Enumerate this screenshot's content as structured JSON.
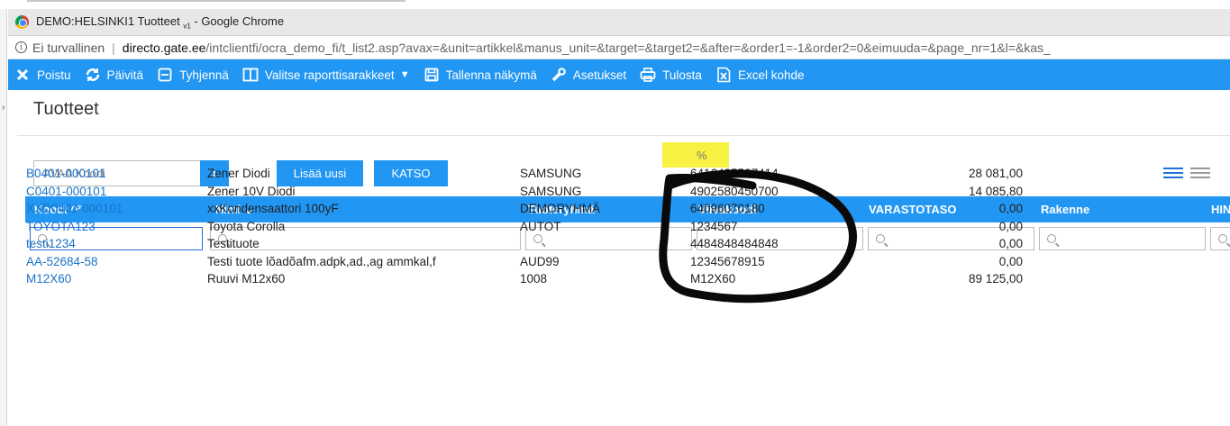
{
  "browser": {
    "window_title": "DEMO:HELSINKI1 Tuotteet",
    "window_title_sub": "v1",
    "window_title_app": " - Google Chrome",
    "insecure_label": "Ei turvallinen",
    "url_host": "directo.gate.ee",
    "url_path": "/intclientfi/ocra_demo_fi/t_list2.asp?avax=&unit=artikkel&manus_unit=&target=&target2=&after=&order1=-1&order2=0&eimuuda=&page_nr=1&l=&kas_"
  },
  "toolbar": {
    "items": [
      {
        "label": "Poistu",
        "icon": "close-icon"
      },
      {
        "label": "Päivitä",
        "icon": "refresh-icon"
      },
      {
        "label": "Tyhjennä",
        "icon": "minus-box-icon"
      },
      {
        "label": "Valitse raporttisarakkeet",
        "icon": "columns-icon"
      },
      {
        "label": "Tallenna näkymä",
        "icon": "save-icon"
      },
      {
        "label": "Asetukset",
        "icon": "wrench-icon"
      },
      {
        "label": "Tulosta",
        "icon": "print-icon"
      },
      {
        "label": "Excel kohde",
        "icon": "excel-icon"
      }
    ]
  },
  "page": {
    "title": "Tuotteet",
    "search_placeholder": "AVAA Koodi",
    "search_go": "›",
    "add_button": "Lisää uusi",
    "view_button": "KATSO"
  },
  "table": {
    "headers": [
      "Koodi ^²",
      "Nimi ⌄",
      "Tuoteryhmä",
      "Viivakoodi",
      "VARASTOTASO",
      "Rakenne",
      "HIN"
    ],
    "filter_value_barcode": "%",
    "rows": [
      {
        "code": "B0401-000101",
        "name": "Zener Diodi",
        "group": "SAMSUNG",
        "barcode": "6416485537414",
        "stock": "28 081,00"
      },
      {
        "code": "C0401-000101",
        "name": "Zener 10V Diodi",
        "group": "SAMSUNG",
        "barcode": "4902580450700",
        "stock": "14 085,80"
      },
      {
        "code": "XXD0401-000101",
        "name": "xxKondensaattori 100yF",
        "group": "DEMORYHMÄ",
        "barcode": "64096070180",
        "stock": "0,00"
      },
      {
        "code": "TOYOTA123",
        "name": "Toyota Corolla",
        "group": "AUTOT",
        "barcode": "1234567",
        "stock": "0,00"
      },
      {
        "code": "testi1234",
        "name": "Testituote",
        "group": "",
        "barcode": "4484848484848",
        "stock": "0,00"
      },
      {
        "code": "AA-52684-58",
        "name": "Testi tuote lõadõafm.adpk,ad.,ag ammkal,f",
        "group": "AUD99",
        "barcode": "12345678915",
        "stock": "0,00"
      },
      {
        "code": "M12X60",
        "name": "Ruuvi M12x60",
        "group": "1008",
        "barcode": "M12X60",
        "stock": "89 125,00"
      }
    ]
  },
  "colors": {
    "toolbar": "#2196f3",
    "link": "#1a73c8",
    "highlight": "#f6ef2d"
  }
}
